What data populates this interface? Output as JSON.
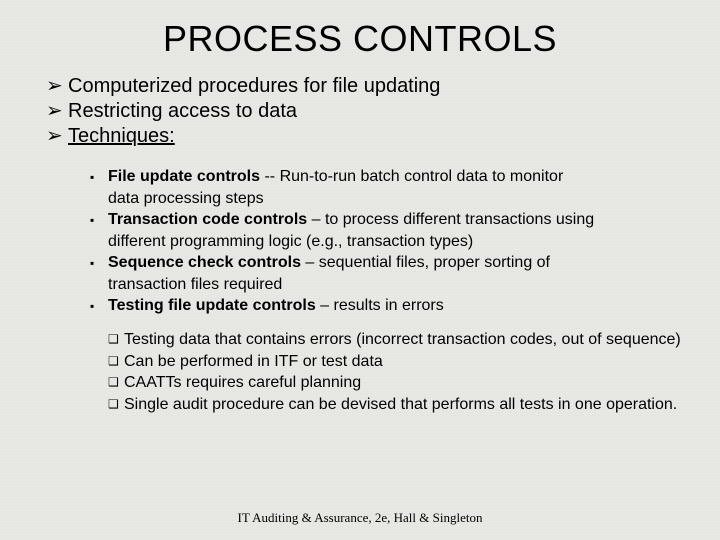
{
  "title": "PROCESS CONTROLS",
  "level1": [
    {
      "text": "Computerized procedures for file updating",
      "underline": false
    },
    {
      "text": "Restricting access to data",
      "underline": false
    },
    {
      "text": "Techniques:",
      "underline": true
    }
  ],
  "level2": [
    {
      "lead": "File update controls",
      "rest": " -- Run-to-run batch control data to monitor",
      "cont": "data processing steps"
    },
    {
      "lead": "Transaction code controls",
      "rest": " – to process different transactions using",
      "cont": "different programming logic (e.g., transaction types)"
    },
    {
      "lead": "Sequence check controls",
      "rest": " – sequential files, proper sorting of",
      "cont": "transaction files required"
    },
    {
      "lead": "Testing file update controls",
      "rest": " – results in errors",
      "cont": ""
    }
  ],
  "level3": [
    "Testing data that contains errors (incorrect transaction codes, out of sequence)",
    "Can be performed in ITF or test data",
    "CAATTs requires careful planning",
    "Single audit procedure can be devised that performs all tests in one operation."
  ],
  "bullets": {
    "arrow": "➢",
    "square_filled": "▪",
    "square_outline": "❑"
  },
  "footer": "IT Auditing & Assurance, 2e, Hall & Singleton"
}
